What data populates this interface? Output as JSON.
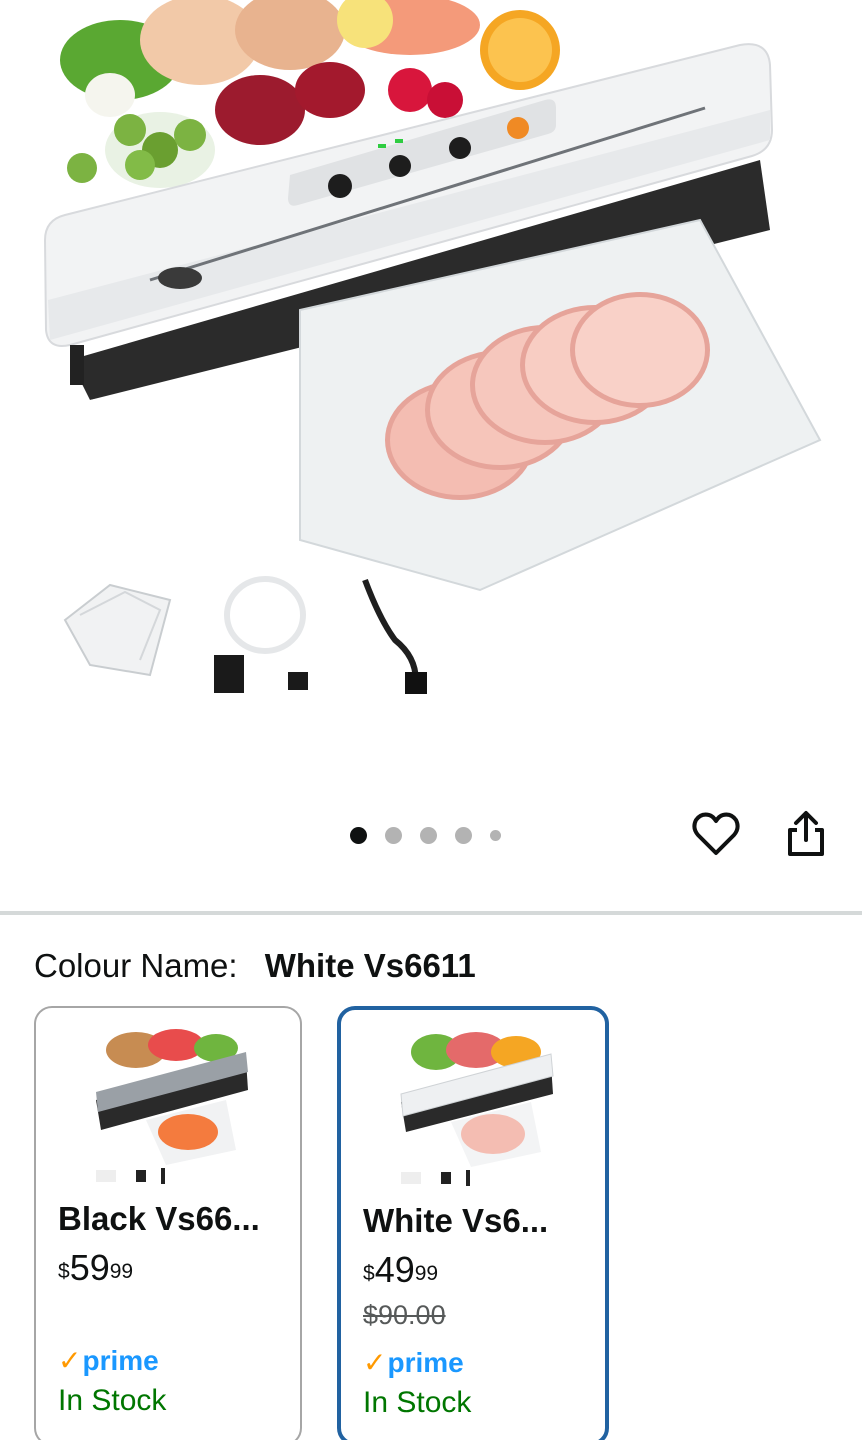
{
  "hero": {
    "carousel": {
      "count": 5,
      "active_index": 0
    },
    "icons": {
      "wishlist": "heart-icon",
      "share": "share-icon"
    }
  },
  "variation": {
    "label": "Colour Name:",
    "selected_value": "White Vs6611",
    "options": [
      {
        "title": "Black Vs66...",
        "price_currency": "$",
        "price_whole": "59",
        "price_fraction": "99",
        "list_price": "",
        "prime": "prime",
        "availability": "In Stock",
        "selected": false
      },
      {
        "title": "White Vs6...",
        "price_currency": "$",
        "price_whole": "49",
        "price_fraction": "99",
        "list_price": "$90.00",
        "prime": "prime",
        "availability": "In Stock",
        "selected": true
      }
    ]
  },
  "colors": {
    "selected_border": "#2162a1",
    "prime_blue": "#1a98ff",
    "prime_check": "#ff9900",
    "in_stock": "#007600"
  }
}
